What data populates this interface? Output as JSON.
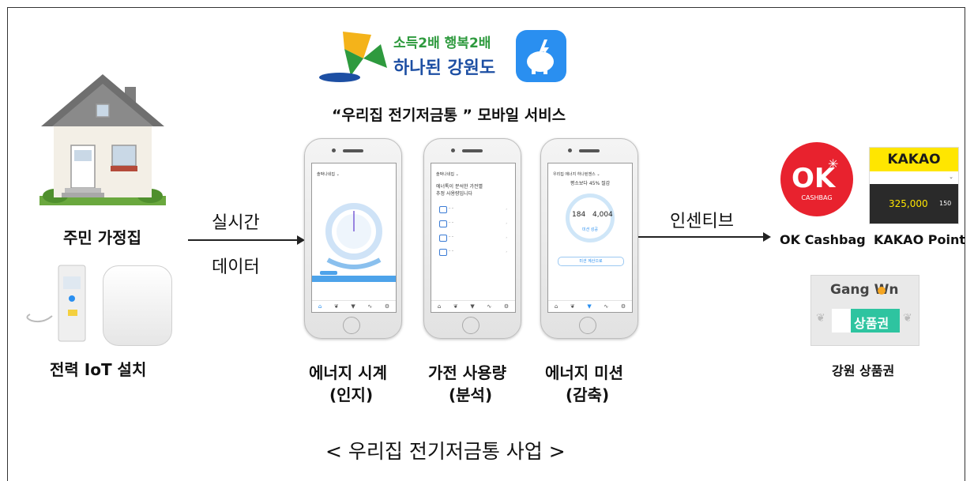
{
  "header": {
    "logo_line1": "소득2배 행복2배",
    "logo_line2": "하나된 강원도",
    "service_title": "“우리집 전기저금통 ” 모바일 서비스"
  },
  "left": {
    "home_label": "주민 가정집",
    "iot_label": "전력 IoT 설치"
  },
  "flow": {
    "realtime": "실시간",
    "data": "데이터",
    "incentive": "인센티브"
  },
  "phones": [
    {
      "title": "에너지 시계",
      "sub": "(인지)"
    },
    {
      "title": "가전 사용량",
      "sub": "(분석)"
    },
    {
      "title": "에너지 미션",
      "sub": "(감축)"
    }
  ],
  "phone_screens": {
    "p1_top": "솔박나네집 ⌄",
    "p2_top": "솔박나네집 ⌄",
    "p2_msg1": "에너톡이 분석한 가전별",
    "p2_msg2": "추정 사용량입니다",
    "p3_top": "우리집 에너지 하나된젠스 ⌄",
    "p3_headline": "평소보다 45% 절감",
    "p3_val1": "184",
    "p3_val2": "4,004",
    "p3_btn": "미션 성공",
    "p3_footer_btn": "미션 계산으로"
  },
  "rewards": {
    "ok_logo": "OK",
    "ok_sub": "CASHBAG",
    "ok_label": "OK Cashbag",
    "kakao_logo": "KAKAO",
    "kakao_amount": "325,000",
    "kakao_small": "150",
    "kakao_label": "KAKAO Point",
    "gangwon_title": "Gang Wn",
    "gangwon_voucher": "상품권",
    "gangwon_label": "강원 상품권"
  },
  "caption": "< 우리집 전기저금통 사업 >",
  "colors": {
    "ok_red": "#e8222e",
    "kakao_yellow": "#ffe600",
    "app_blue": "#2a8ff0",
    "voucher_green": "#2ec4a0",
    "logo_green": "#2e9a3e"
  }
}
